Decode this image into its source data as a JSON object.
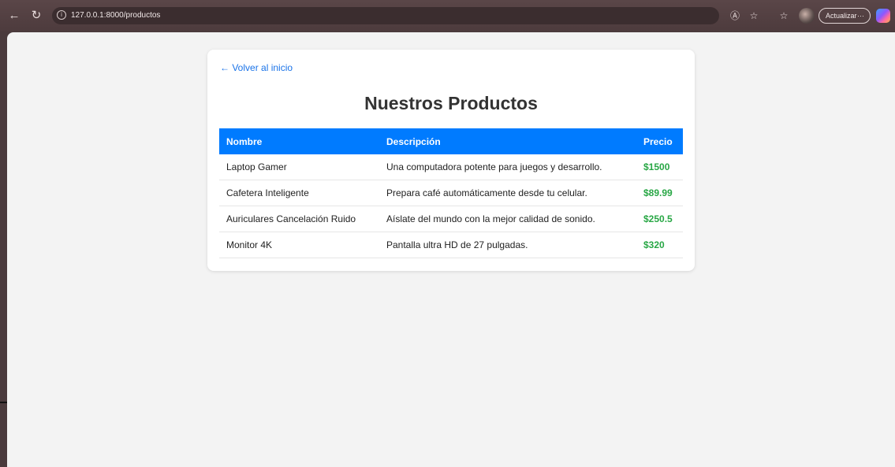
{
  "browser": {
    "url": "127.0.0.1:8000/productos",
    "update_label": "Actualizar",
    "more_label": "···",
    "icons": [
      "back-arrow-icon",
      "reload-icon",
      "info-icon",
      "read-aloud-icon",
      "favorite-star-icon",
      "favorites-list-icon",
      "profile-avatar",
      "copilot-icon"
    ]
  },
  "page": {
    "back_link": "← Volver al inicio",
    "title": "Nuestros Productos",
    "table": {
      "headers": [
        "Nombre",
        "Descripción",
        "Precio"
      ],
      "rows": [
        {
          "nombre": "Laptop Gamer",
          "descripcion": "Una computadora potente para juegos y desarrollo.",
          "precio": "$1500"
        },
        {
          "nombre": "Cafetera Inteligente",
          "descripcion": "Prepara café automáticamente desde tu celular.",
          "precio": "$89.99"
        },
        {
          "nombre": "Auriculares Cancelación Ruido",
          "descripcion": "Aíslate del mundo con la mejor calidad de sonido.",
          "precio": "$250.5"
        },
        {
          "nombre": "Monitor 4K",
          "descripcion": "Pantalla ultra HD de 27 pulgadas.",
          "precio": "$320"
        }
      ]
    }
  },
  "colors": {
    "header_bg": "#007bff",
    "price": "#28a745",
    "link": "#1a73e8",
    "page_bg": "#f3f3f3"
  }
}
